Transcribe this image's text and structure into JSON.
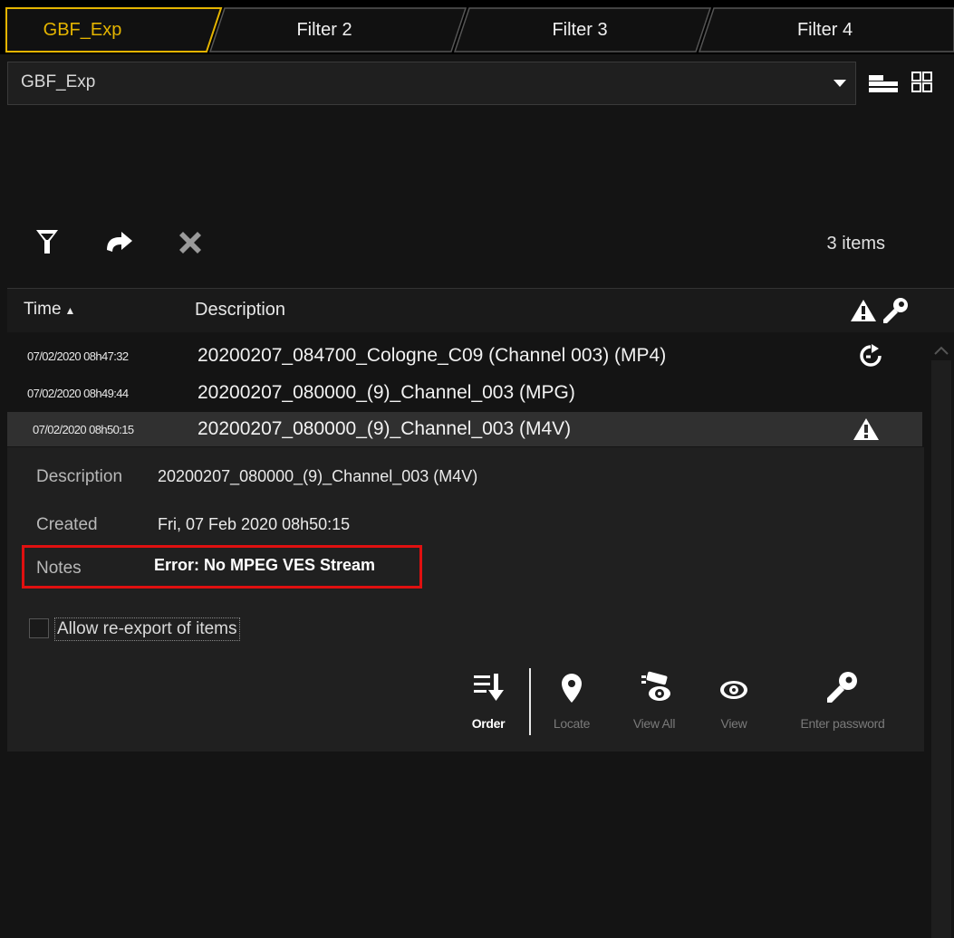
{
  "tabs": [
    {
      "label": "GBF_Exp",
      "active": true
    },
    {
      "label": "Filter 2",
      "active": false
    },
    {
      "label": "Filter 3",
      "active": false
    },
    {
      "label": "Filter 4",
      "active": false
    }
  ],
  "combo": {
    "value": "GBF_Exp"
  },
  "toolbar": {
    "items_count": "3 items"
  },
  "header": {
    "time": "Time",
    "sort_arrow": "▲",
    "description": "Description"
  },
  "rows": [
    {
      "time": "07/02/2020 08h47:32",
      "description": "20200207_084700_Cologne_C09 (Channel 003) (MP4)",
      "status_icon": "refresh-icon"
    },
    {
      "time": "07/02/2020 08h49:44",
      "description": "20200207_080000_(9)_Channel_003 (MPG)",
      "status_icon": ""
    },
    {
      "time": "07/02/2020 08h50:15",
      "description": "20200207_080000_(9)_Channel_003 (M4V)",
      "status_icon": "warning-icon"
    }
  ],
  "detail": {
    "description_label": "Description",
    "description_value": "20200207_080000_(9)_Channel_003 (M4V)",
    "created_label": "Created",
    "created_value": "Fri, 07 Feb 2020  08h50:15",
    "notes_label": "Notes",
    "notes_value": "Error: No MPEG VES Stream",
    "allow_reexport_label": "Allow re-export of items",
    "allow_reexport_checked": false
  },
  "actions": [
    {
      "label": "Order",
      "icon": "order-icon",
      "enabled": true
    },
    {
      "label": "Locate",
      "icon": "location-pin-icon",
      "enabled": false
    },
    {
      "label": "View All",
      "icon": "camera-view-icon",
      "enabled": false
    },
    {
      "label": "View",
      "icon": "eye-icon",
      "enabled": false
    },
    {
      "label": "Enter password",
      "icon": "key-icon",
      "enabled": false
    }
  ],
  "colors": {
    "accent": "#e4b400",
    "highlight": "#e01010"
  }
}
